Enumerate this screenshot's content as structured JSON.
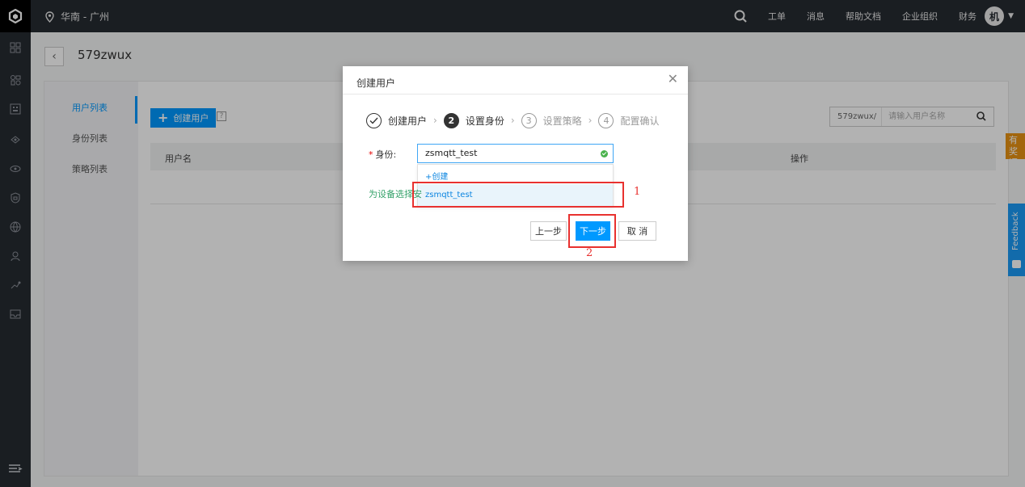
{
  "topbar": {
    "region": "华南 - 广州",
    "nav": [
      "工单",
      "消息",
      "帮助文档",
      "企业组织",
      "财务"
    ],
    "avatar_text": "机"
  },
  "page": {
    "title": "579zwux"
  },
  "subnav": {
    "items": [
      "用户列表",
      "身份列表",
      "策略列表"
    ]
  },
  "toolbar": {
    "create_label": "创建用户",
    "help": "?",
    "search_prefix": "579zwux/",
    "search_placeholder": "请输入用户名称"
  },
  "table": {
    "headers": [
      "用户名",
      "操作"
    ]
  },
  "side": {
    "float_text": "有奖调研",
    "feedback": "Feedback"
  },
  "modal": {
    "title": "创建用户",
    "steps": [
      {
        "num": "1",
        "label": "创建用户",
        "state": "done"
      },
      {
        "num": "2",
        "label": "设置身份",
        "state": "current"
      },
      {
        "num": "3",
        "label": "设置策略",
        "state": "pending"
      },
      {
        "num": "4",
        "label": "配置确认",
        "state": "pending"
      }
    ],
    "field_label": "身份:",
    "field_required": "*",
    "field_value": "zsmqtt_test",
    "dropdown_create": "+创建",
    "dropdown_selected": "zsmqtt_test",
    "helper_text": "为设备选择安",
    "buttons": {
      "prev": "上一步",
      "next": "下一步",
      "cancel": "取 消"
    }
  },
  "annotations": {
    "one": "1",
    "two": "2"
  },
  "colors": {
    "accent": "#0099ff",
    "annotation": "#e8312f",
    "sidebar": "#262b32"
  }
}
